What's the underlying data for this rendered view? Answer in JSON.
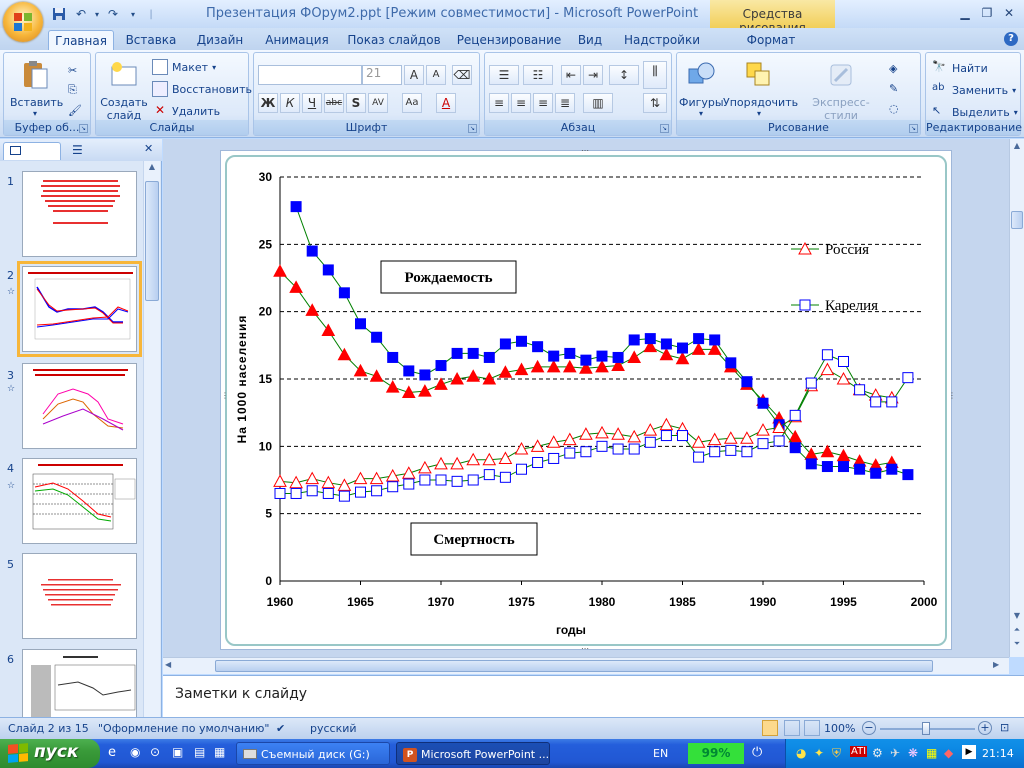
{
  "window": {
    "title": "Презентация ФОрум2.ppt [Режим совместимости] - Microsoft PowerPoint",
    "context_tab_title": "Средства рисования"
  },
  "tabs": [
    "Главная",
    "Вставка",
    "Дизайн",
    "Анимация",
    "Показ слайдов",
    "Рецензирование",
    "Вид",
    "Надстройки",
    "Формат"
  ],
  "ribbon": {
    "clipboard": {
      "label": "Буфер об...",
      "paste": "Вставить"
    },
    "slides": {
      "label": "Слайды",
      "new_slide": "Создать слайд",
      "layout": "Макет",
      "reset": "Восстановить",
      "delete": "Удалить"
    },
    "font": {
      "label": "Шрифт",
      "font_name": "",
      "font_size": "21"
    },
    "paragraph": {
      "label": "Абзац"
    },
    "drawing": {
      "label": "Рисование",
      "shapes": "Фигуры",
      "arrange": "Упорядочить",
      "quick_styles": "Экспресс-стили"
    },
    "editing": {
      "label": "Редактирование",
      "find": "Найти",
      "replace": "Заменить",
      "select": "Выделить"
    }
  },
  "slides_pane": {
    "thumbs": [
      {
        "num": "1"
      },
      {
        "num": "2"
      },
      {
        "num": "3"
      },
      {
        "num": "4"
      },
      {
        "num": "5"
      },
      {
        "num": "6"
      }
    ]
  },
  "chart_data": {
    "type": "line",
    "ylabel": "На 1000 населения",
    "xlabel": "годы",
    "ylim": [
      0,
      30
    ],
    "xlim": [
      1960,
      2000
    ],
    "yticks": [
      "0",
      "5",
      "10",
      "15",
      "20",
      "25",
      "30"
    ],
    "xticks": [
      "1960",
      "1965",
      "1970",
      "1975",
      "1980",
      "1985",
      "1990",
      "1995",
      "2000"
    ],
    "legend_position": "top-right",
    "grid": "horizontal-dashed",
    "annotations": [
      "Рождаемость",
      "Смертность"
    ],
    "series": [
      {
        "name": "Россия",
        "group": "birth",
        "marker": "triangle",
        "color": "#ff0000",
        "x": [
          1960,
          1961,
          1962,
          1963,
          1964,
          1965,
          1966,
          1967,
          1968,
          1969,
          1970,
          1971,
          1972,
          1973,
          1974,
          1975,
          1976,
          1977,
          1978,
          1979,
          1980,
          1981,
          1982,
          1983,
          1984,
          1985,
          1986,
          1987,
          1988,
          1989,
          1990,
          1991,
          1992,
          1993,
          1994,
          1995,
          1996,
          1997,
          1998
        ],
        "y": [
          23.0,
          21.8,
          20.1,
          18.6,
          16.8,
          15.6,
          15.2,
          14.4,
          14.0,
          14.1,
          14.6,
          15.0,
          15.2,
          15.0,
          15.5,
          15.7,
          15.9,
          15.9,
          15.9,
          15.8,
          15.9,
          16.0,
          16.6,
          17.4,
          16.8,
          16.5,
          17.2,
          17.2,
          15.9,
          14.6,
          13.4,
          12.1,
          10.7,
          9.4,
          9.6,
          9.3,
          8.9,
          8.6,
          8.8
        ]
      },
      {
        "name": "Карелия",
        "group": "birth",
        "marker": "square",
        "color": "#0000ff",
        "x": [
          1961,
          1962,
          1963,
          1964,
          1965,
          1966,
          1967,
          1968,
          1969,
          1970,
          1971,
          1972,
          1973,
          1974,
          1975,
          1976,
          1977,
          1978,
          1979,
          1980,
          1981,
          1982,
          1983,
          1984,
          1985,
          1986,
          1987,
          1988,
          1989,
          1990,
          1991,
          1992,
          1993,
          1994,
          1995,
          1996,
          1997,
          1998,
          1999
        ],
        "y": [
          27.8,
          24.5,
          23.1,
          21.4,
          19.1,
          18.1,
          16.6,
          15.6,
          15.3,
          16.0,
          16.9,
          16.9,
          16.6,
          17.6,
          17.8,
          17.4,
          16.7,
          16.9,
          16.4,
          16.7,
          16.6,
          17.9,
          18.0,
          17.6,
          17.3,
          18.0,
          17.9,
          16.2,
          14.8,
          13.2,
          11.6,
          9.9,
          8.7,
          8.5,
          8.5,
          8.3,
          8.0,
          8.3,
          7.9
        ]
      },
      {
        "name": "Россия",
        "group": "death",
        "marker": "triangle-open",
        "color": "#ff0000",
        "x": [
          1960,
          1961,
          1962,
          1963,
          1964,
          1965,
          1966,
          1967,
          1968,
          1969,
          1970,
          1971,
          1972,
          1973,
          1974,
          1975,
          1976,
          1977,
          1978,
          1979,
          1980,
          1981,
          1982,
          1983,
          1984,
          1985,
          1986,
          1987,
          1988,
          1989,
          1990,
          1991,
          1992,
          1993,
          1994,
          1995,
          1996,
          1997,
          1998
        ],
        "y": [
          7.4,
          7.3,
          7.6,
          7.3,
          7.1,
          7.6,
          7.6,
          7.8,
          8.0,
          8.4,
          8.7,
          8.7,
          9.0,
          9.0,
          9.1,
          9.8,
          10.0,
          10.3,
          10.5,
          10.9,
          11.0,
          10.9,
          10.7,
          11.2,
          11.6,
          11.3,
          10.3,
          10.5,
          10.6,
          10.6,
          11.2,
          11.4,
          12.2,
          14.5,
          15.7,
          15.0,
          14.2,
          13.8,
          13.6
        ]
      },
      {
        "name": "Карелия",
        "group": "death",
        "marker": "square-open",
        "color": "#0000ff",
        "x": [
          1960,
          1961,
          1962,
          1963,
          1964,
          1965,
          1966,
          1967,
          1968,
          1969,
          1970,
          1971,
          1972,
          1973,
          1974,
          1975,
          1976,
          1977,
          1978,
          1979,
          1980,
          1981,
          1982,
          1983,
          1984,
          1985,
          1986,
          1987,
          1988,
          1989,
          1990,
          1991,
          1992,
          1993,
          1994,
          1995,
          1996,
          1997,
          1998,
          1999
        ],
        "y": [
          6.5,
          6.5,
          6.7,
          6.5,
          6.3,
          6.6,
          6.7,
          7.0,
          7.2,
          7.5,
          7.5,
          7.4,
          7.5,
          7.9,
          7.7,
          8.3,
          8.8,
          9.1,
          9.5,
          9.6,
          10.0,
          9.8,
          9.8,
          10.3,
          10.8,
          10.8,
          9.2,
          9.6,
          9.7,
          9.6,
          10.2,
          10.4,
          12.3,
          14.7,
          16.8,
          16.3,
          14.2,
          13.3,
          13.3,
          15.1
        ]
      }
    ]
  },
  "notes": {
    "placeholder": "Заметки к слайду"
  },
  "status": {
    "slide": "Слайд 2 из 15",
    "theme": "\"Оформление по умолчанию\"",
    "language": "русский",
    "zoom": "100%"
  },
  "taskbar": {
    "start": "пуск",
    "tasks": [
      "Съемный диск (G:)",
      "Microsoft PowerPoint ..."
    ],
    "lang": "EN",
    "battery": "99%",
    "clock": "21:14"
  }
}
